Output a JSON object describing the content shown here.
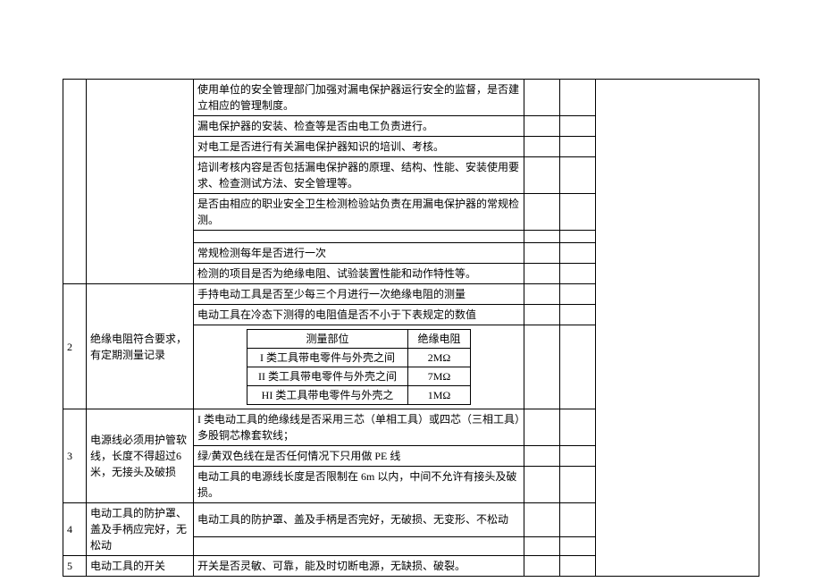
{
  "rows": {
    "r1": "使用单位的安全管理部门加强对漏电保护器运行安全的监督，是否建立相应的管理制度。",
    "r2": "漏电保护器的安装、检查等是否由电工负责进行。",
    "r3": "对电工是否进行有关漏电保护器知识的培训、考核。",
    "r4": "培训考核内容是否包括漏电保护器的原理、结构、性能、安装使用要求、检查测试方法、安全管理等。",
    "r5": "是否由相应的职业安全卫生检测检验站负责在用漏电保护器的常规检测。",
    "r6": "",
    "r7": "常规检测每年是否进行一次",
    "r8": "检测的项目是否为绝缘电阻、试验装置性能和动作特性等。"
  },
  "sec2": {
    "num": "2",
    "req": "绝缘电阻符合要求，有定期测量记录",
    "row1": "手持电动工具是否至少每三个月进行一次绝缘电阻的测量",
    "row2": "电动工具在冷态下测得的电阻值是否不小于下表规定的数值",
    "inner": {
      "h1": "测量部位",
      "h2": "绝缘电阻",
      "r1c1": "I 类工具带电零件与外壳之间",
      "r1c2": "2MΩ",
      "r2c1": "II 类工具带电零件与外壳之间",
      "r2c2": "7MΩ",
      "r3c1": "HI 类工具带电零件与外壳之",
      "r3c2": "1MΩ"
    }
  },
  "sec3": {
    "num": "3",
    "req": "电源线必须用护管软线，长度不得超过6 米，无接头及破损",
    "row1": "I 类电动工具的绝缘线是否采用三芯（单相工具）或四芯（三相工具）多股铜芯橡套软线；",
    "row2": "绿/黄双色线在是否任何情况下只用做 PE 线",
    "row3": "电动工具的电源线长度是否限制在 6m 以内，中间不允许有接头及破损。"
  },
  "sec4": {
    "num": "4",
    "req": "电动工具的防护罩、盖及手柄应完好，无松动",
    "row1": "电动工具的防护罩、盖及手柄是否完好，无破损、无变形、不松动"
  },
  "sec5": {
    "num": "5",
    "req": "电动工具的开关",
    "row1": "开关是否灵敏、可靠，能及时切断电源，无缺损、破裂。"
  }
}
